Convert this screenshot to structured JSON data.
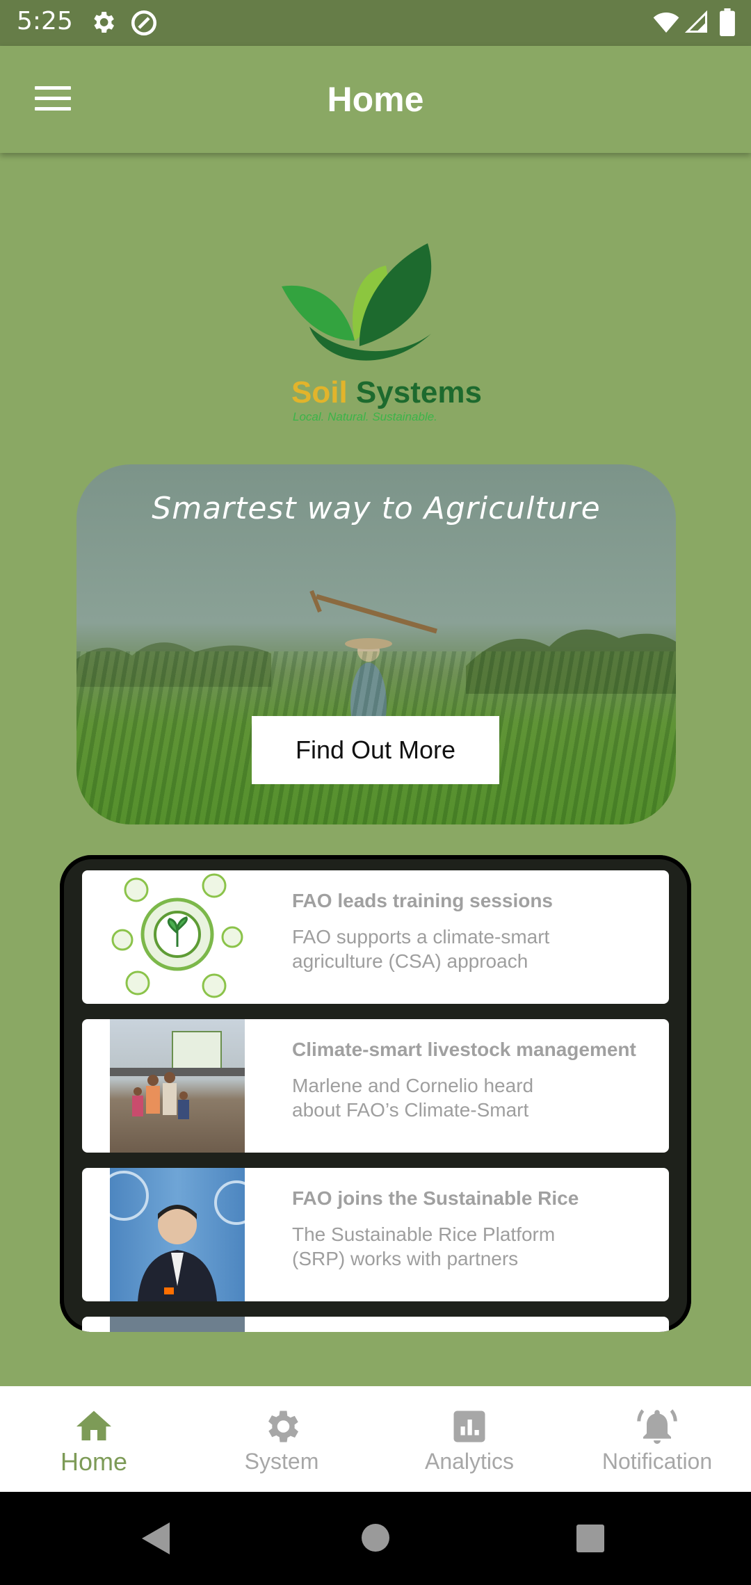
{
  "status_bar": {
    "time": "5:25"
  },
  "app_bar": {
    "title": "Home"
  },
  "logo": {
    "brand_first": "Soil",
    "brand_second": "Systems",
    "tagline": "Local. Natural. Sustainable."
  },
  "hero": {
    "headline": "Smartest way to Agriculture",
    "button_label": "Find Out More"
  },
  "news": [
    {
      "title": "FAO leads training sessions",
      "description": "FAO supports a climate-smart agriculture (CSA) approach"
    },
    {
      "title": "Climate-smart livestock management",
      "description": "Marlene and Cornelio heard about FAO’s Climate-Smart"
    },
    {
      "title": "FAO joins the Sustainable Rice",
      "description": "The Sustainable Rice Platform (SRP) works with partners"
    }
  ],
  "bottom_nav": {
    "items": [
      {
        "label": "Home",
        "icon": "home-icon",
        "active": true
      },
      {
        "label": "System",
        "icon": "gear-icon",
        "active": false
      },
      {
        "label": "Analytics",
        "icon": "analytics-icon",
        "active": false
      },
      {
        "label": "Notification",
        "icon": "bell-icon",
        "active": false
      }
    ]
  },
  "colors": {
    "primary": "#8aa864",
    "status_bar": "#667d48",
    "active_nav": "#7d9b57",
    "inactive_nav": "#a7a7a7"
  }
}
